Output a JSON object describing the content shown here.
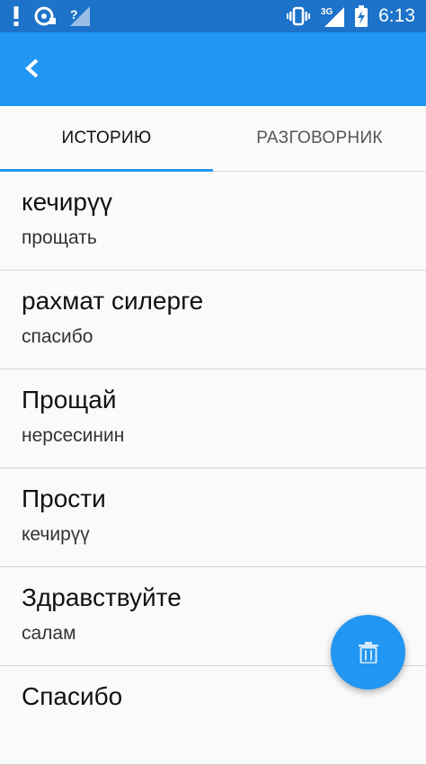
{
  "status_bar": {
    "time": "6:13",
    "icons": [
      "alert-icon",
      "sync-icon",
      "wifi-unknown-icon",
      "vibrate-icon",
      "signal-3g-icon",
      "battery-charging-icon"
    ],
    "network_label": "3G"
  },
  "app_bar": {
    "back_icon": "chevron-left-icon"
  },
  "tabs": [
    {
      "label": "ИСТОРИЮ",
      "active": true
    },
    {
      "label": "РАЗГОВОРНИК",
      "active": false
    }
  ],
  "history": [
    {
      "primary": "кечирүү",
      "secondary": "прощать"
    },
    {
      "primary": "рахмат силерге",
      "secondary": "спасибо"
    },
    {
      "primary": "Прощай",
      "secondary": "нерсесинин"
    },
    {
      "primary": "Прости",
      "secondary": "кечирүү"
    },
    {
      "primary": "Здравствуйте",
      "secondary": "салам"
    },
    {
      "primary": "Спасибо",
      "secondary": ""
    }
  ],
  "fab": {
    "icon": "trash-icon"
  },
  "colors": {
    "status_bar": "#1d72c9",
    "app_bar": "#2196f3",
    "accent": "#2196f3"
  }
}
